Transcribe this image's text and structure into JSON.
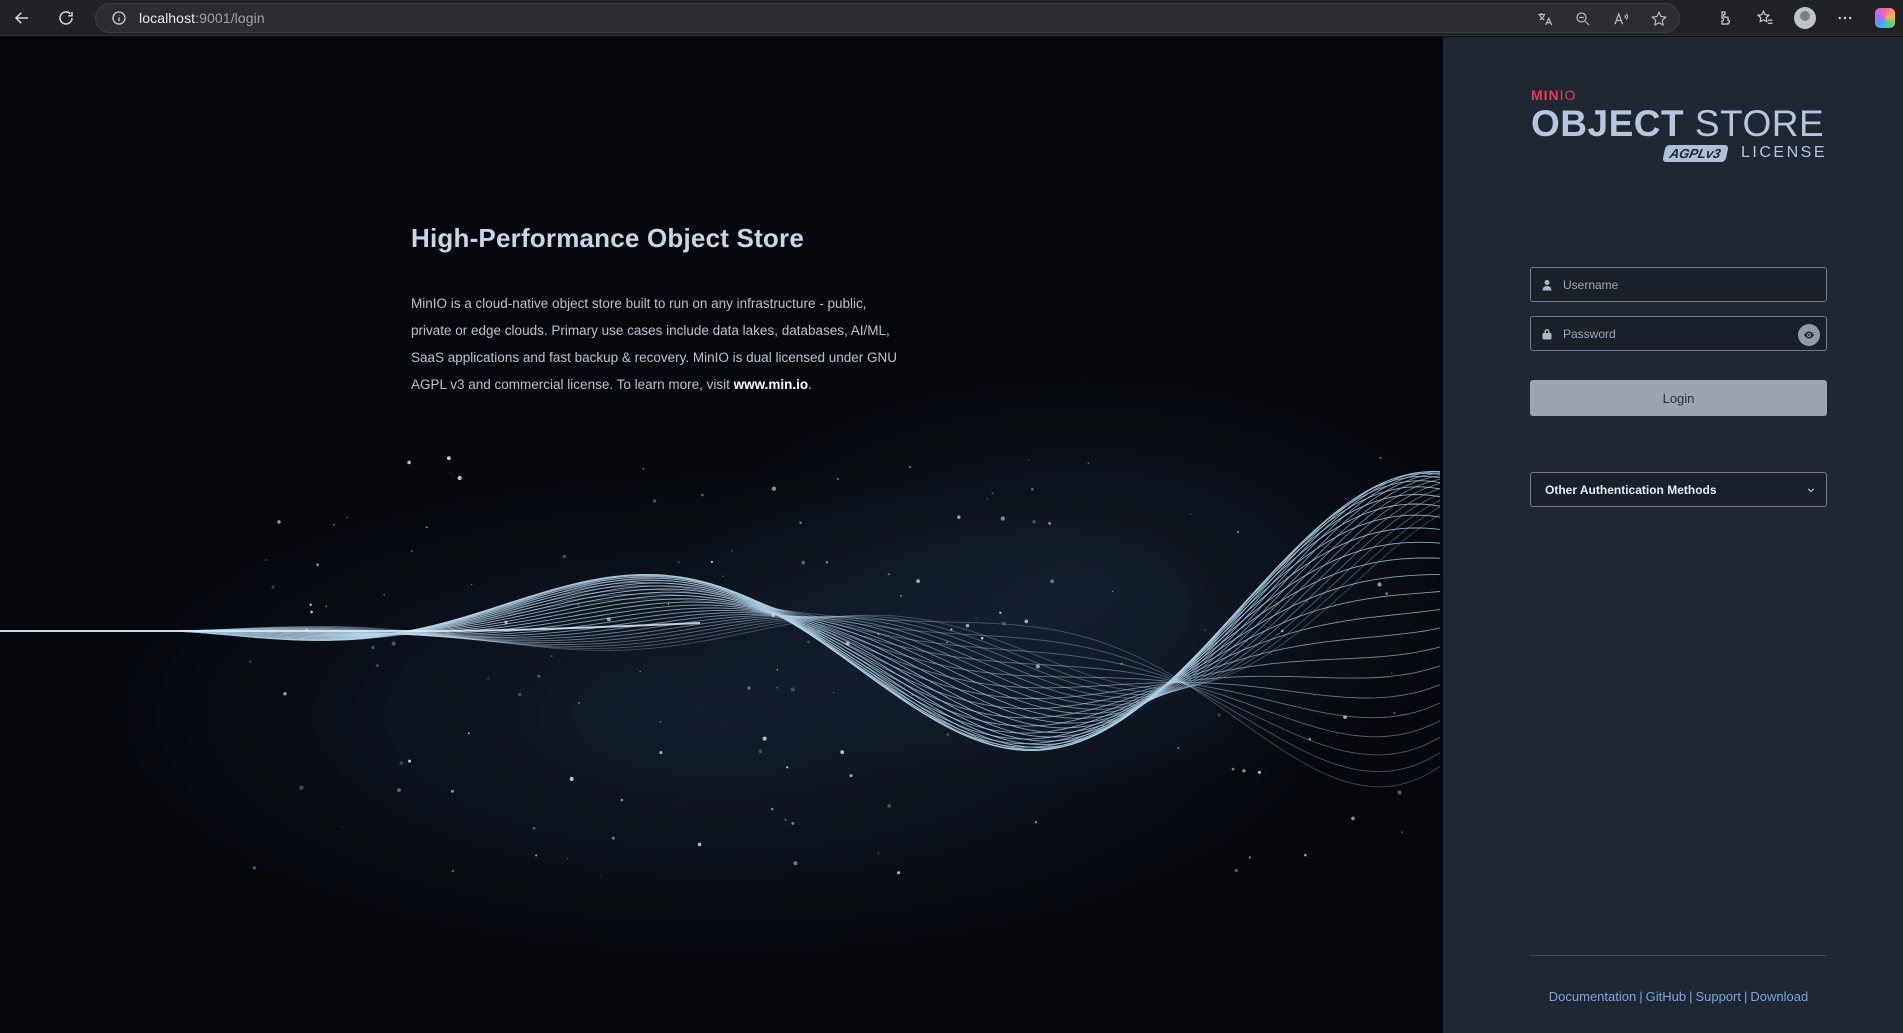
{
  "browser": {
    "url_host": "localhost",
    "url_rest": ":9001/login"
  },
  "hero": {
    "title": "High-Performance Object Store",
    "description": "MinIO is a cloud-native object store built to run on any infrastructure - public, private or edge clouds. Primary use cases include data lakes, databases, AI/ML, SaaS applications and fast backup & recovery. MinIO is dual licensed under GNU AGPL v3 and commercial license. To learn more, visit ",
    "link_text": "www.min.io",
    "end": "."
  },
  "logo": {
    "brand_min": "MIN",
    "brand_io": "IO",
    "main_bold": "OBJECT",
    "main_light": "STORE",
    "badge": "AGPLv3",
    "license": "LICENSE"
  },
  "login": {
    "username_placeholder": "Username",
    "password_placeholder": "Password",
    "login_label": "Login",
    "other_auth_label": "Other Authentication Methods"
  },
  "footer": {
    "links": [
      "Documentation",
      "GitHub",
      "Support",
      "Download"
    ],
    "separator": "|"
  },
  "colors": {
    "brand_red": "#ea3b52",
    "panel_bg": "#1f2733",
    "link_blue": "#7ea2e0"
  }
}
